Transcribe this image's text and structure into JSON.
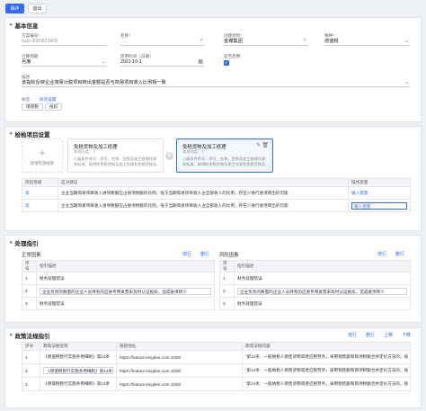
{
  "toolbar": {
    "save": "保存",
    "exit": "退出"
  },
  "basic": {
    "title": "基本信息",
    "fields": {
      "code": {
        "label": "方案编号",
        "value": "fxdz-0080823409"
      },
      "name": {
        "label": "名称",
        "value": ""
      },
      "org": {
        "label": "创建组织",
        "value": "金蝶集团"
      },
      "tax": {
        "label": "税种",
        "value": "增值税"
      },
      "period_type": {
        "label": "计算周期",
        "value": "月度"
      },
      "start": {
        "label": "启用时间（日期）",
        "value": "2021-10-1"
      },
      "enabled": {
        "label": "是否启用",
        "value": ""
      },
      "desc": {
        "label": "描述",
        "value": "该指标反映企业简易计税项目转出金额是否与简易项目收入比例相一致"
      },
      "tags_label": "标签",
      "tag_setting": "标签设置",
      "tags": [
        "增值税",
        "抵扣"
      ]
    }
  },
  "check": {
    "title": "检检项目设置",
    "add_label": "新增检测规则",
    "cards": [
      {
        "title": "免税货物及加工修理",
        "subtitle": "本规则类：1",
        "body": "二级条件序号：序号、名称、货物及加工修理作规划标准、取得的免税货物及加工作规划免税货物及..."
      },
      {
        "title": "免税货物及加工修理",
        "subtitle": "本规则类：1",
        "body": "二级条件序号：序号、名称、货物及加工修理作规划标准、取得的免税货物及加工作规划免税货物及..."
      }
    ],
    "table": {
      "headers": [
        "风险等级",
        "应对建议",
        "操作变量"
      ],
      "rows": [
        {
          "level": "高",
          "advice": "企业当期简易项目收入进项税额应占进项税额的比例，低于当期简易项目收入占全部收入的比例，存在少进行进项转出的可能",
          "var": "输入变量"
        },
        {
          "level": "高",
          "advice": "企业当期简易项目收入进项税额应占进项税额的比例，低于当期简易项目收入占全部收入的比例，存在少进行进项转出的可能",
          "var": "输入变量"
        }
      ]
    }
  },
  "handle": {
    "title": "处理指引",
    "normal": {
      "label": "正常因素",
      "add": "增行",
      "del": "删行",
      "headers": [
        "序号",
        "指引描述"
      ],
      "rows": [
        {
          "no": "1",
          "desc": "财务处理错误"
        },
        {
          "no": "2",
          "desc": "企业负责的数量的企业人员持有的应进专用发票未及时认证抵扣，造成进项转少"
        },
        {
          "no": "3",
          "desc": "财务处理错误"
        }
      ]
    },
    "risk": {
      "label": "风险因素",
      "add": "增行",
      "del": "删行",
      "headers": [
        "序号",
        "指引描述"
      ],
      "rows": [
        {
          "no": "1",
          "desc": "财务处理错误"
        },
        {
          "no": "2",
          "desc": "企业负责的数量的企业人员持有的应进专用发票未及时认证抵扣，造成进项转少"
        },
        {
          "no": "3",
          "desc": "财务处理错误"
        }
      ]
    }
  },
  "policy": {
    "title": "政策法规指引",
    "actions": [
      "增行",
      "删行",
      "上移",
      "下移"
    ],
    "headers": [
      "序号",
      "政策法规名称",
      "链接地址",
      "政策法规内容"
    ],
    "rows": [
      {
        "no": "1",
        "name": "《增值税暂行实施条例细则》第14条",
        "url": "https://feature.kingdee.com:1026/",
        "content": "“第14条：一般纳税人销售货物或者应税劳务，采用销售额和销项税额合并定价方法的，按"
      },
      {
        "no": "2",
        "name": "《增值税暂行实施条例细则》第14条",
        "url": "https://feature.kingdee.com:1026/",
        "content": "“第14条：一般纳税人销售货物或者应税劳务，采用销售额和销项税额合并定价方法的，按"
      },
      {
        "no": "3",
        "name": "《增值税暂行实施条例细则》第14条",
        "url": "https://feature.kingdee.com:1026/",
        "content": "“第14条：一般纳税人销售货物或者应税劳务，采用销售额和销项税额合并定价方法的，按"
      }
    ]
  }
}
